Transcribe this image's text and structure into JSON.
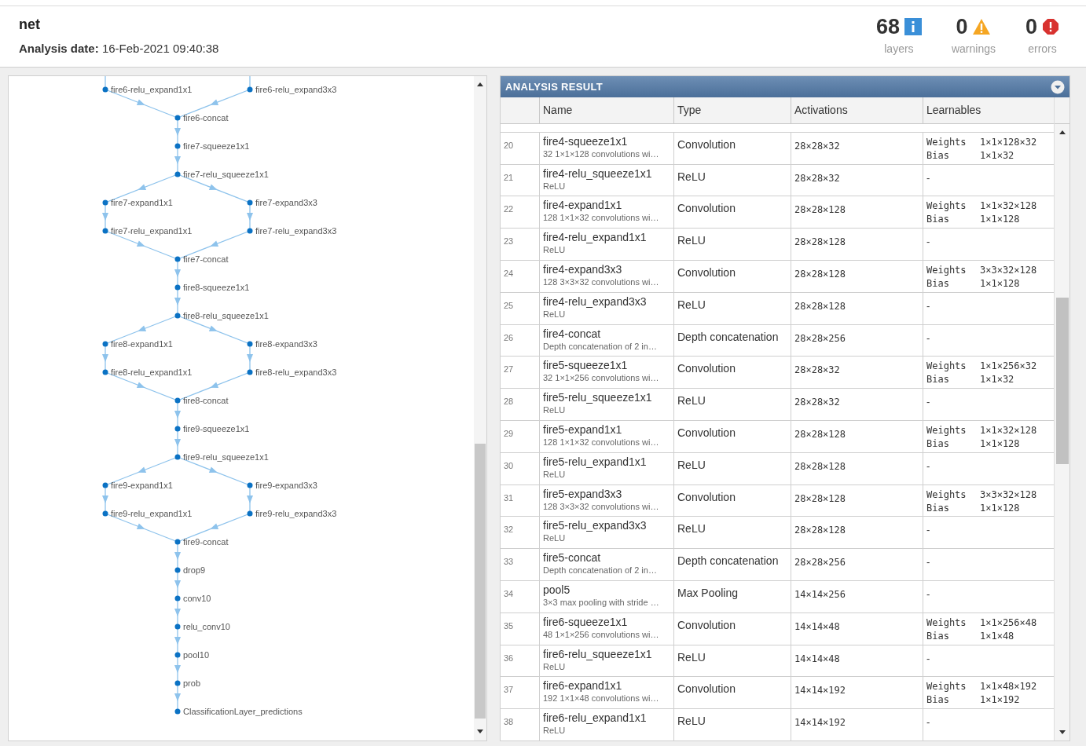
{
  "header": {
    "title": "net",
    "date_label": "Analysis date:",
    "date_value": "16-Feb-2021 09:40:38",
    "stats": [
      {
        "kind": "info",
        "count": "68",
        "label": "layers"
      },
      {
        "kind": "warning",
        "count": "0",
        "label": "warnings"
      },
      {
        "kind": "error",
        "count": "0",
        "label": "errors"
      }
    ]
  },
  "graph": {
    "rows": [
      [
        "fire6-relu_expand1x1",
        "fire6-relu_expand3x3"
      ],
      [
        "fire6-concat"
      ],
      [
        "fire7-squeeze1x1"
      ],
      [
        "fire7-relu_squeeze1x1"
      ],
      [
        "fire7-expand1x1",
        "fire7-expand3x3"
      ],
      [
        "fire7-relu_expand1x1",
        "fire7-relu_expand3x3"
      ],
      [
        "fire7-concat"
      ],
      [
        "fire8-squeeze1x1"
      ],
      [
        "fire8-relu_squeeze1x1"
      ],
      [
        "fire8-expand1x1",
        "fire8-expand3x3"
      ],
      [
        "fire8-relu_expand1x1",
        "fire8-relu_expand3x3"
      ],
      [
        "fire8-concat"
      ],
      [
        "fire9-squeeze1x1"
      ],
      [
        "fire9-relu_squeeze1x1"
      ],
      [
        "fire9-expand1x1",
        "fire9-expand3x3"
      ],
      [
        "fire9-relu_expand1x1",
        "fire9-relu_expand3x3"
      ],
      [
        "fire9-concat"
      ],
      [
        "drop9"
      ],
      [
        "conv10"
      ],
      [
        "relu_conv10"
      ],
      [
        "pool10"
      ],
      [
        "prob"
      ],
      [
        "ClassificationLayer_predictions"
      ]
    ]
  },
  "results": {
    "title": "ANALYSIS RESULT",
    "columns": [
      "Name",
      "Type",
      "Activations",
      "Learnables"
    ],
    "rows": [
      {
        "index": "20",
        "name": "fire4-squeeze1x1",
        "description": "32 1×1×128 convolutions wi…",
        "type": "Convolution",
        "activations": "28×28×32",
        "learnables": [
          {
            "name": "Weights",
            "size": "1×1×128×32"
          },
          {
            "name": "Bias",
            "size": "1×1×32"
          }
        ]
      },
      {
        "index": "21",
        "name": "fire4-relu_squeeze1x1",
        "description": "ReLU",
        "type": "ReLU",
        "activations": "28×28×32",
        "learnables": "-"
      },
      {
        "index": "22",
        "name": "fire4-expand1x1",
        "description": "128 1×1×32 convolutions wi…",
        "type": "Convolution",
        "activations": "28×28×128",
        "learnables": [
          {
            "name": "Weights",
            "size": "1×1×32×128"
          },
          {
            "name": "Bias",
            "size": "1×1×128"
          }
        ]
      },
      {
        "index": "23",
        "name": "fire4-relu_expand1x1",
        "description": "ReLU",
        "type": "ReLU",
        "activations": "28×28×128",
        "learnables": "-"
      },
      {
        "index": "24",
        "name": "fire4-expand3x3",
        "description": "128 3×3×32 convolutions wi…",
        "type": "Convolution",
        "activations": "28×28×128",
        "learnables": [
          {
            "name": "Weights",
            "size": "3×3×32×128"
          },
          {
            "name": "Bias",
            "size": "1×1×128"
          }
        ]
      },
      {
        "index": "25",
        "name": "fire4-relu_expand3x3",
        "description": "ReLU",
        "type": "ReLU",
        "activations": "28×28×128",
        "learnables": "-"
      },
      {
        "index": "26",
        "name": "fire4-concat",
        "description": "Depth concatenation of 2 in…",
        "type": "Depth concatenation",
        "activations": "28×28×256",
        "learnables": "-"
      },
      {
        "index": "27",
        "name": "fire5-squeeze1x1",
        "description": "32 1×1×256 convolutions wi…",
        "type": "Convolution",
        "activations": "28×28×32",
        "learnables": [
          {
            "name": "Weights",
            "size": "1×1×256×32"
          },
          {
            "name": "Bias",
            "size": "1×1×32"
          }
        ]
      },
      {
        "index": "28",
        "name": "fire5-relu_squeeze1x1",
        "description": "ReLU",
        "type": "ReLU",
        "activations": "28×28×32",
        "learnables": "-"
      },
      {
        "index": "29",
        "name": "fire5-expand1x1",
        "description": "128 1×1×32 convolutions wi…",
        "type": "Convolution",
        "activations": "28×28×128",
        "learnables": [
          {
            "name": "Weights",
            "size": "1×1×32×128"
          },
          {
            "name": "Bias",
            "size": "1×1×128"
          }
        ]
      },
      {
        "index": "30",
        "name": "fire5-relu_expand1x1",
        "description": "ReLU",
        "type": "ReLU",
        "activations": "28×28×128",
        "learnables": "-"
      },
      {
        "index": "31",
        "name": "fire5-expand3x3",
        "description": "128 3×3×32 convolutions wi…",
        "type": "Convolution",
        "activations": "28×28×128",
        "learnables": [
          {
            "name": "Weights",
            "size": "3×3×32×128"
          },
          {
            "name": "Bias",
            "size": "1×1×128"
          }
        ]
      },
      {
        "index": "32",
        "name": "fire5-relu_expand3x3",
        "description": "ReLU",
        "type": "ReLU",
        "activations": "28×28×128",
        "learnables": "-"
      },
      {
        "index": "33",
        "name": "fire5-concat",
        "description": "Depth concatenation of 2 in…",
        "type": "Depth concatenation",
        "activations": "28×28×256",
        "learnables": "-"
      },
      {
        "index": "34",
        "name": "pool5",
        "description": "3×3 max pooling with stride …",
        "type": "Max Pooling",
        "activations": "14×14×256",
        "learnables": "-"
      },
      {
        "index": "35",
        "name": "fire6-squeeze1x1",
        "description": "48 1×1×256 convolutions wi…",
        "type": "Convolution",
        "activations": "14×14×48",
        "learnables": [
          {
            "name": "Weights",
            "size": "1×1×256×48"
          },
          {
            "name": "Bias",
            "size": "1×1×48"
          }
        ]
      },
      {
        "index": "36",
        "name": "fire6-relu_squeeze1x1",
        "description": "ReLU",
        "type": "ReLU",
        "activations": "14×14×48",
        "learnables": "-"
      },
      {
        "index": "37",
        "name": "fire6-expand1x1",
        "description": "192 1×1×48 convolutions wi…",
        "type": "Convolution",
        "activations": "14×14×192",
        "learnables": [
          {
            "name": "Weights",
            "size": "1×1×48×192"
          },
          {
            "name": "Bias",
            "size": "1×1×192"
          }
        ]
      },
      {
        "index": "38",
        "name": "fire6-relu_expand1x1",
        "description": "ReLU",
        "type": "ReLU",
        "activations": "14×14×192",
        "learnables": "-"
      }
    ]
  }
}
